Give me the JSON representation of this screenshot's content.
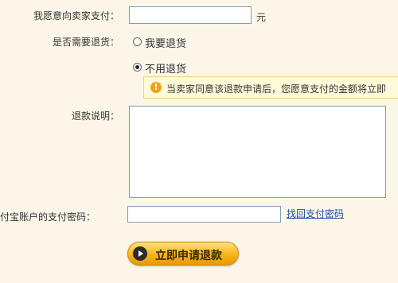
{
  "form": {
    "pay_label": "我愿意向卖家支付：",
    "pay_value": "",
    "pay_unit": "元",
    "return_label": "是否需要退货：",
    "return_options": [
      {
        "label": "我要退货",
        "selected": false
      },
      {
        "label": "不用退货",
        "selected": true
      }
    ],
    "notice_text": "当卖家同意该退款申请后，您愿意支付的金额将立即",
    "explain_label": "退款说明：",
    "explain_value": "",
    "password_label": "付宝账户的支付密码：",
    "password_value": "",
    "forgot_password_link": "找回支付密码",
    "submit_label": "立即申请退款"
  }
}
